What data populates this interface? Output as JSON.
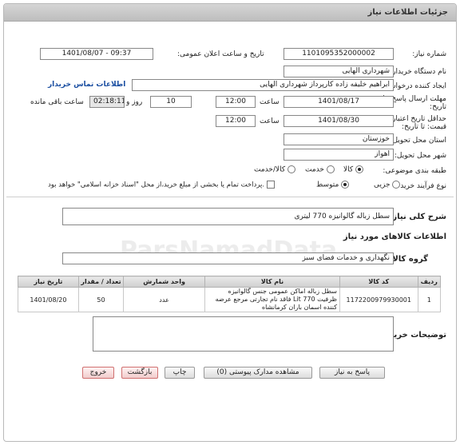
{
  "header": {
    "title": "جزئیات اطلاعات نیاز"
  },
  "form": {
    "need_number_label": "شماره نیاز:",
    "need_number": "1101095352000002",
    "announce_label": "تاریخ و ساعت اعلان عمومی:",
    "announce_value": "1401/08/07 - 09:37",
    "buyer_label": "نام دستگاه خریدار:",
    "buyer_value": "شهرداری الهایی",
    "creator_label": "ایجاد کننده درخواست:",
    "creator_value": "ابراهیم خلیفه زاده کارپرداز شهرداری الهایی",
    "contact_link": "اطلاعات تماس خریدار",
    "deadline_label_1": "مهلت ارسال پاسخ: تا",
    "deadline_label_2": "تاریخ:",
    "deadline_date": "1401/08/17",
    "time_label": "ساعت",
    "deadline_time": "12:00",
    "days_value": "10",
    "days_label": "روز و",
    "remaining_time": "02:18:11",
    "remaining_label": "ساعت باقی مانده",
    "min_validity_label_1": "حداقل تاریخ اعتبار",
    "min_validity_label_2": "قیمت: تا تاریخ:",
    "validity_date": "1401/08/30",
    "validity_time": "12:00",
    "province_label": "استان محل تحویل:",
    "province_value": "خوزستان",
    "city_label": "شهر محل تحویل:",
    "city_value": "اهواز",
    "category_label": "طبقه بندی موضوعی:",
    "category_options": [
      "کالا",
      "خدمت",
      "کالا/خدمت"
    ],
    "process_label": "نوع فرآیند خرید :",
    "process_options": [
      "جزیی",
      "متوسط"
    ],
    "payment_note": "پرداخت تمام یا بخشی از مبلغ خرید،از محل \"اسناد خزانه اسلامی\" خواهد بود."
  },
  "summary": {
    "label": "شرح کلی نیاز:",
    "value": "سطل زباله گالوانیزه 770 لیتری"
  },
  "goods": {
    "section_title": "اطلاعات کالاهای مورد نیاز",
    "group_label": "گروه کالا:",
    "group_value": "نگهداری و خدمات فضای سبز",
    "columns": [
      "ردیف",
      "کد کالا",
      "نام کالا",
      "واحد شمارش",
      "تعداد / مقدار",
      "تاریخ نیاز"
    ],
    "rows": [
      {
        "row": "1",
        "code": "1172200979930001",
        "name": "سطل زباله اماکن عمومی جنس گالوانیزه ظرفیت Lit 770 فاقد نام تجارتی مرجع عرضه کننده اسمان باران کرمانشاه",
        "unit": "عدد",
        "qty": "50",
        "date": "1401/08/20"
      }
    ]
  },
  "notes": {
    "label": "توضیحات خریدار:",
    "value": ""
  },
  "buttons": {
    "reply": "پاسخ به نیاز",
    "docs": "مشاهده مدارک پیوستی (0)",
    "print": "چاپ",
    "back": "بازگشت",
    "exit": "خروج"
  },
  "watermark": {
    "brand": "ParsNamadData"
  }
}
